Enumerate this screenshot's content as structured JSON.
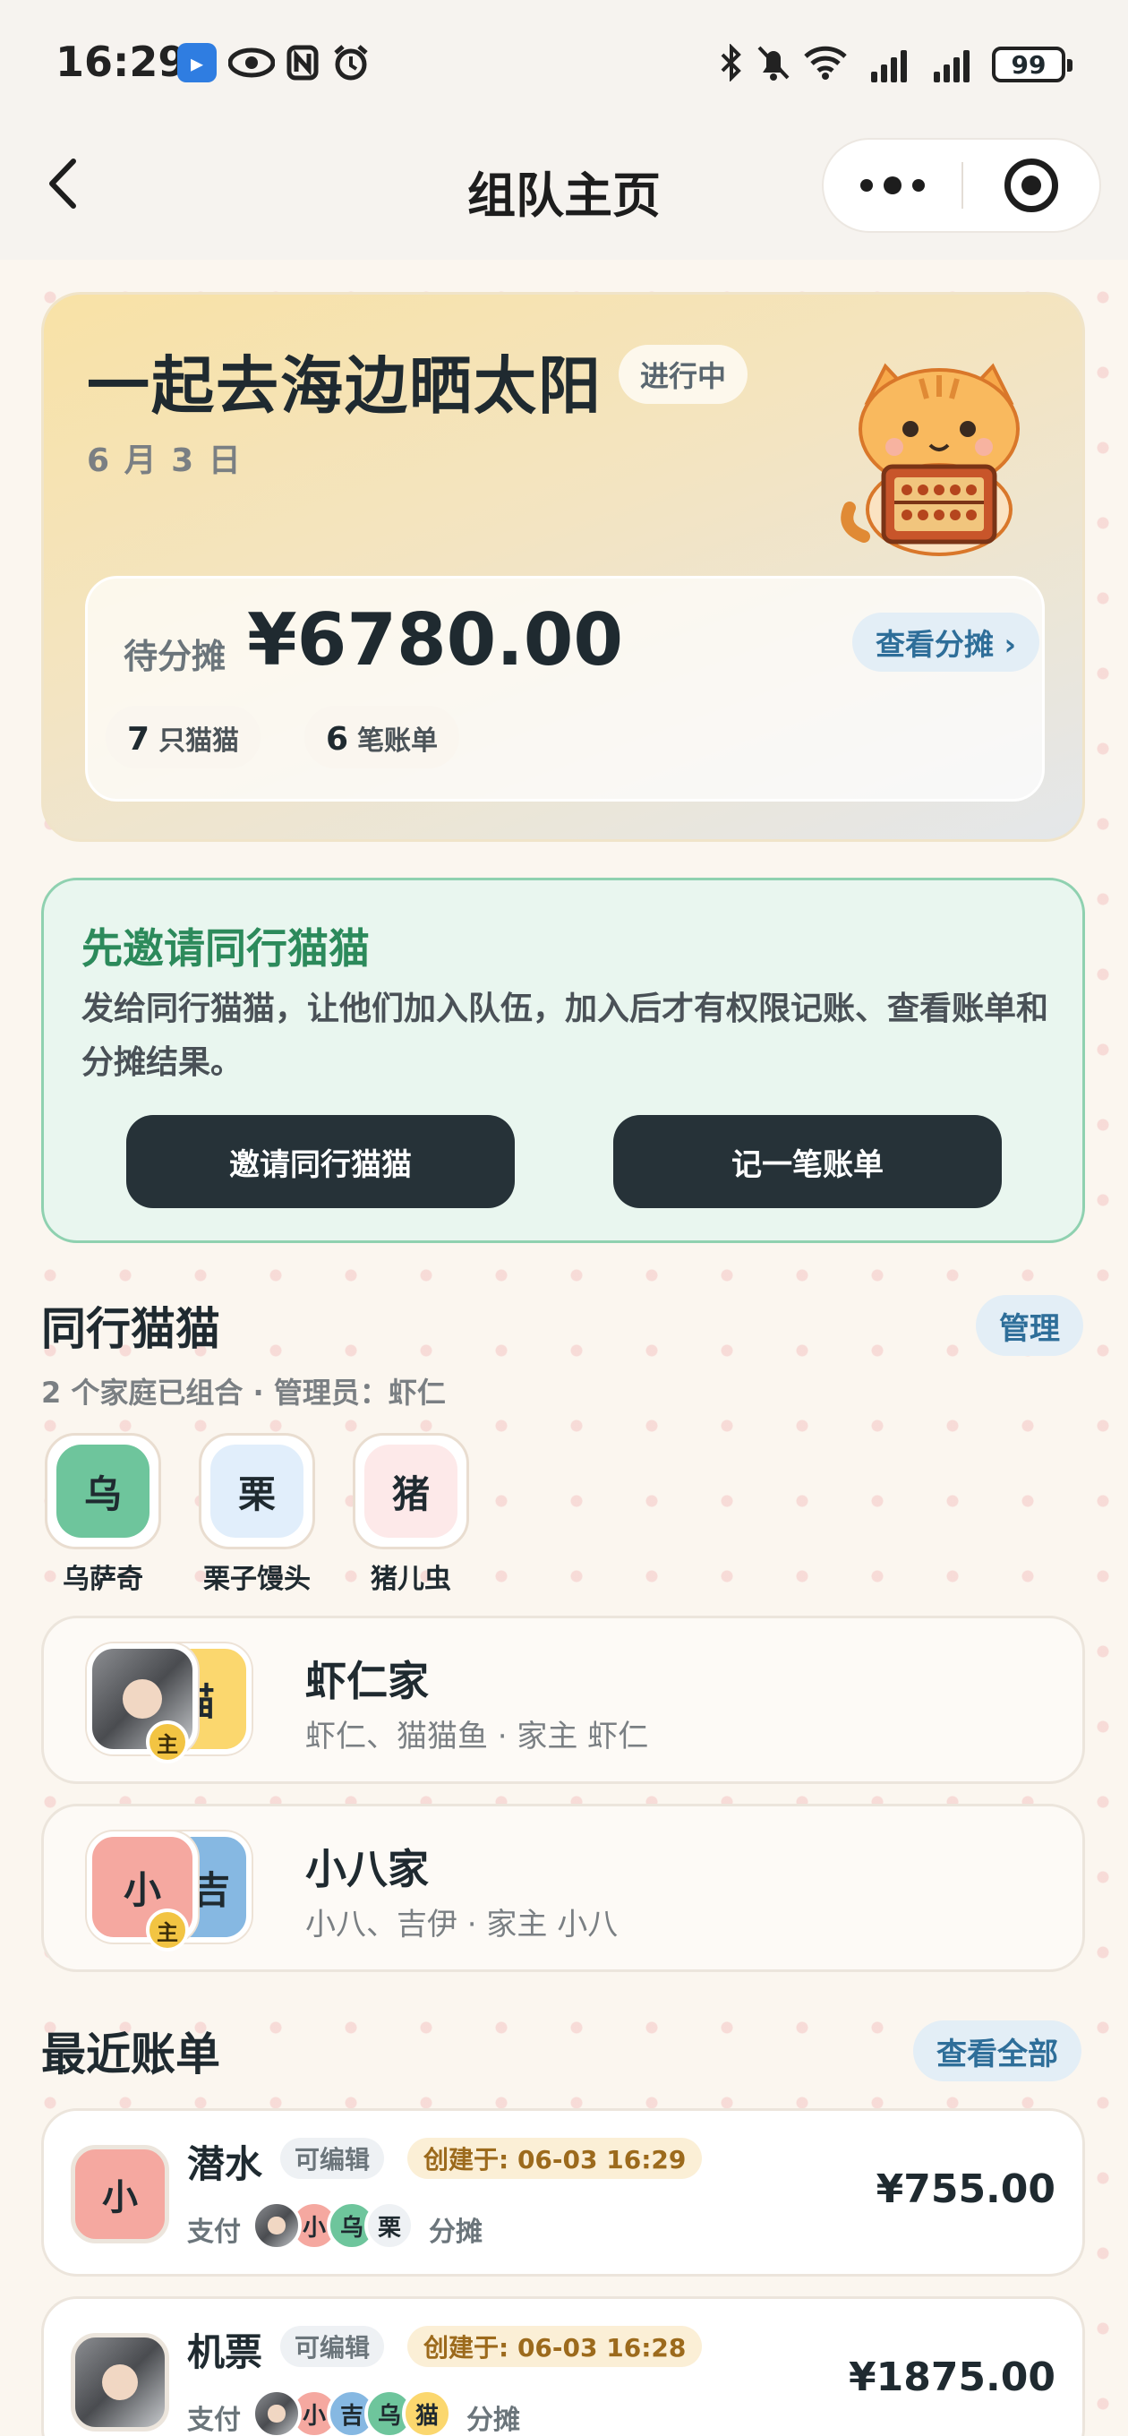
{
  "status_bar": {
    "time": "16:29",
    "battery": "99"
  },
  "nav": {
    "title": "组队主页"
  },
  "hero": {
    "title": "一起去海边晒太阳",
    "status_badge": "进行中",
    "date": "6 月 3 日",
    "pending_label": "待分摊",
    "amount": "¥6780.00",
    "view_split": "查看分摊 ›",
    "cats_count": "7",
    "cats_label": "只猫猫",
    "bills_count": "6",
    "bills_label": "笔账单"
  },
  "invite": {
    "title": "先邀请同行猫猫",
    "desc": "发给同行猫猫，让他们加入队伍，加入后才有权限记账、查看账单和分摊结果。",
    "invite_button": "邀请同行猫猫",
    "record_button": "记一笔账单"
  },
  "companions": {
    "title": "同行猫猫",
    "manage": "管理",
    "subtitle": "2 个家庭已组合 · 管理员：虾仁",
    "members": [
      {
        "initial": "乌",
        "name": "乌萨奇",
        "color": "#6ec59c"
      },
      {
        "initial": "栗",
        "name": "栗子馒头",
        "color": "#e1eefb"
      },
      {
        "initial": "猪",
        "name": "猪儿虫",
        "color": "#fde9e9"
      }
    ],
    "families": [
      {
        "name": "虾仁家",
        "desc": "虾仁、猫猫鱼 · 家主 虾仁",
        "back_initial": "猫",
        "host": "主"
      },
      {
        "name": "小八家",
        "desc": "小八、吉伊 · 家主 小八",
        "front_initial": "小",
        "back_initial": "吉",
        "host": "主"
      }
    ]
  },
  "recent_bills": {
    "title": "最近账单",
    "view_all": "查看全部",
    "pay_label": "支付",
    "split_label": "分摊",
    "items": [
      {
        "avatar_initial": "小",
        "title": "潜水",
        "editable": "可编辑",
        "created": "创建于: 06-03 16:29",
        "amount": "¥755.00",
        "participants": [
          "小",
          "乌",
          "栗"
        ]
      },
      {
        "title": "机票",
        "editable": "可编辑",
        "created": "创建于: 06-03 16:28",
        "amount": "¥1875.00",
        "participants": [
          "小",
          "吉",
          "乌",
          "猫"
        ]
      }
    ]
  },
  "colors": {
    "accent_green": "#2c8a5b",
    "accent_blue": "#2e6e99",
    "dark_button": "#263238"
  }
}
